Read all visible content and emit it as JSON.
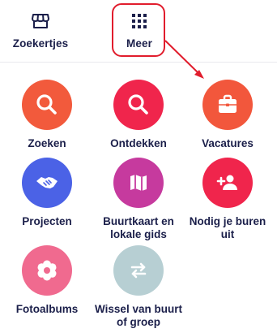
{
  "nav": {
    "tabs": [
      {
        "label": "Zoekertjes",
        "icon": "storefront-icon"
      },
      {
        "label": "Meer",
        "icon": "grid-icon",
        "selected": true
      }
    ]
  },
  "grid": {
    "items": [
      {
        "label": "Zoeken",
        "icon": "search-icon",
        "color": "#f25a3c"
      },
      {
        "label": "Ontdekken",
        "icon": "search-icon",
        "color": "#f0254c"
      },
      {
        "label": "Vacatures",
        "icon": "briefcase-icon",
        "color": "#f2573c"
      },
      {
        "label": "Projecten",
        "icon": "handshake-icon",
        "color": "#4b62e6"
      },
      {
        "label": "Buurtkaart en lokale gids",
        "icon": "map-icon",
        "color": "#c63a9e"
      },
      {
        "label": "Nodig je buren uit",
        "icon": "add-person-icon",
        "color": "#f0254c"
      },
      {
        "label": "Fotoalbums",
        "icon": "flower-icon",
        "color": "#f06a8f"
      },
      {
        "label": "Wissel van buurt of groep",
        "icon": "swap-arrows-icon",
        "color": "#b7cfd3"
      }
    ]
  },
  "colors": {
    "text": "#1b1f4a",
    "annotation": "#e11d2d"
  }
}
